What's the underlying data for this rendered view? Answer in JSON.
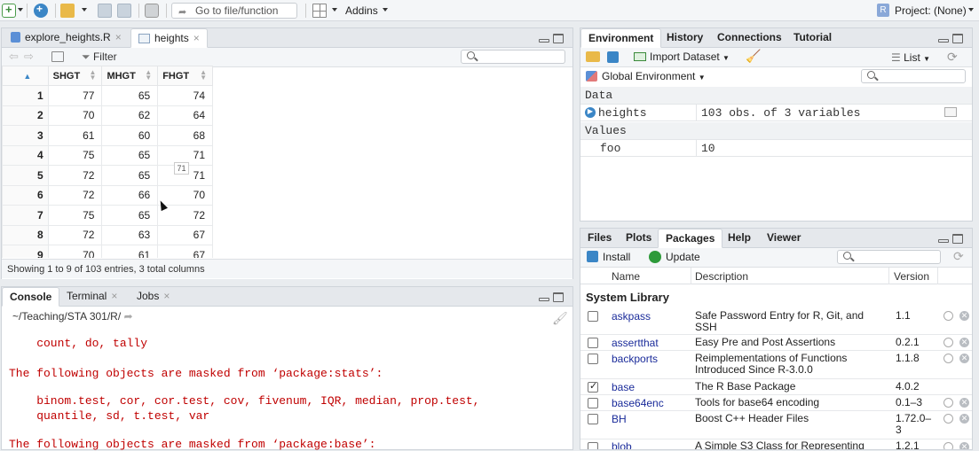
{
  "toolbar": {
    "goto_placeholder": "Go to file/function",
    "addins_label": "Addins",
    "project_label": "Project: (None)"
  },
  "source": {
    "tabs": [
      {
        "label": "explore_heights.R"
      },
      {
        "label": "heights"
      }
    ],
    "filter_label": "Filter",
    "columns": [
      "SHGT",
      "MHGT",
      "FHGT"
    ],
    "rows": [
      {
        "n": "1",
        "v": [
          "77",
          "65",
          "74"
        ]
      },
      {
        "n": "2",
        "v": [
          "70",
          "62",
          "64"
        ]
      },
      {
        "n": "3",
        "v": [
          "61",
          "60",
          "68"
        ]
      },
      {
        "n": "4",
        "v": [
          "75",
          "65",
          "71"
        ]
      },
      {
        "n": "5",
        "v": [
          "72",
          "65",
          "71"
        ]
      },
      {
        "n": "6",
        "v": [
          "72",
          "66",
          "70"
        ]
      },
      {
        "n": "7",
        "v": [
          "75",
          "65",
          "72"
        ]
      },
      {
        "n": "8",
        "v": [
          "72",
          "63",
          "67"
        ]
      },
      {
        "n": "9",
        "v": [
          "70",
          "61",
          "67"
        ]
      }
    ],
    "tooltip": "71",
    "status": "Showing 1 to 9 of 103 entries, 3 total columns"
  },
  "console": {
    "tabs": [
      {
        "label": "Console"
      },
      {
        "label": "Terminal"
      },
      {
        "label": "Jobs"
      }
    ],
    "path": "~/Teaching/STA 301/R/",
    "lines": [
      "    count, do, tally",
      "",
      "The following objects are masked from ‘package:stats’:",
      "",
      "    binom.test, cor, cor.test, cov, fivenum, IQR, median, prop.test,",
      "    quantile, sd, t.test, var",
      "",
      "The following objects are masked from ‘package:base’:"
    ]
  },
  "environment": {
    "tabs": [
      {
        "label": "Environment"
      },
      {
        "label": "History"
      },
      {
        "label": "Connections"
      },
      {
        "label": "Tutorial"
      }
    ],
    "import_label": "Import Dataset",
    "list_label": "List",
    "scope_label": "Global Environment",
    "data_header": "Data",
    "data_rows": [
      {
        "name": "heights",
        "value": "103 obs. of 3 variables"
      }
    ],
    "values_header": "Values",
    "value_rows": [
      {
        "name": "foo",
        "value": "10"
      }
    ]
  },
  "packages": {
    "tabs": [
      {
        "label": "Files"
      },
      {
        "label": "Plots"
      },
      {
        "label": "Packages"
      },
      {
        "label": "Help"
      },
      {
        "label": "Viewer"
      }
    ],
    "install_label": "Install",
    "update_label": "Update",
    "col_name": "Name",
    "col_desc": "Description",
    "col_ver": "Version",
    "section": "System Library",
    "items": [
      {
        "name": "askpass",
        "desc": "Safe Password Entry for R, Git, and SSH",
        "ver": "1.1",
        "checked": false
      },
      {
        "name": "assertthat",
        "desc": "Easy Pre and Post Assertions",
        "ver": "0.2.1",
        "checked": false
      },
      {
        "name": "backports",
        "desc": "Reimplementations of Functions Introduced Since R-3.0.0",
        "ver": "1.1.8",
        "checked": false
      },
      {
        "name": "base",
        "desc": "The R Base Package",
        "ver": "4.0.2",
        "checked": true
      },
      {
        "name": "base64enc",
        "desc": "Tools for base64 encoding",
        "ver": "0.1–3",
        "checked": false
      },
      {
        "name": "BH",
        "desc": "Boost C++ Header Files",
        "ver": "1.72.0– 3",
        "checked": false
      },
      {
        "name": "blob",
        "desc": "A Simple S3 Class for Representing",
        "ver": "1.2.1",
        "checked": false
      }
    ]
  }
}
